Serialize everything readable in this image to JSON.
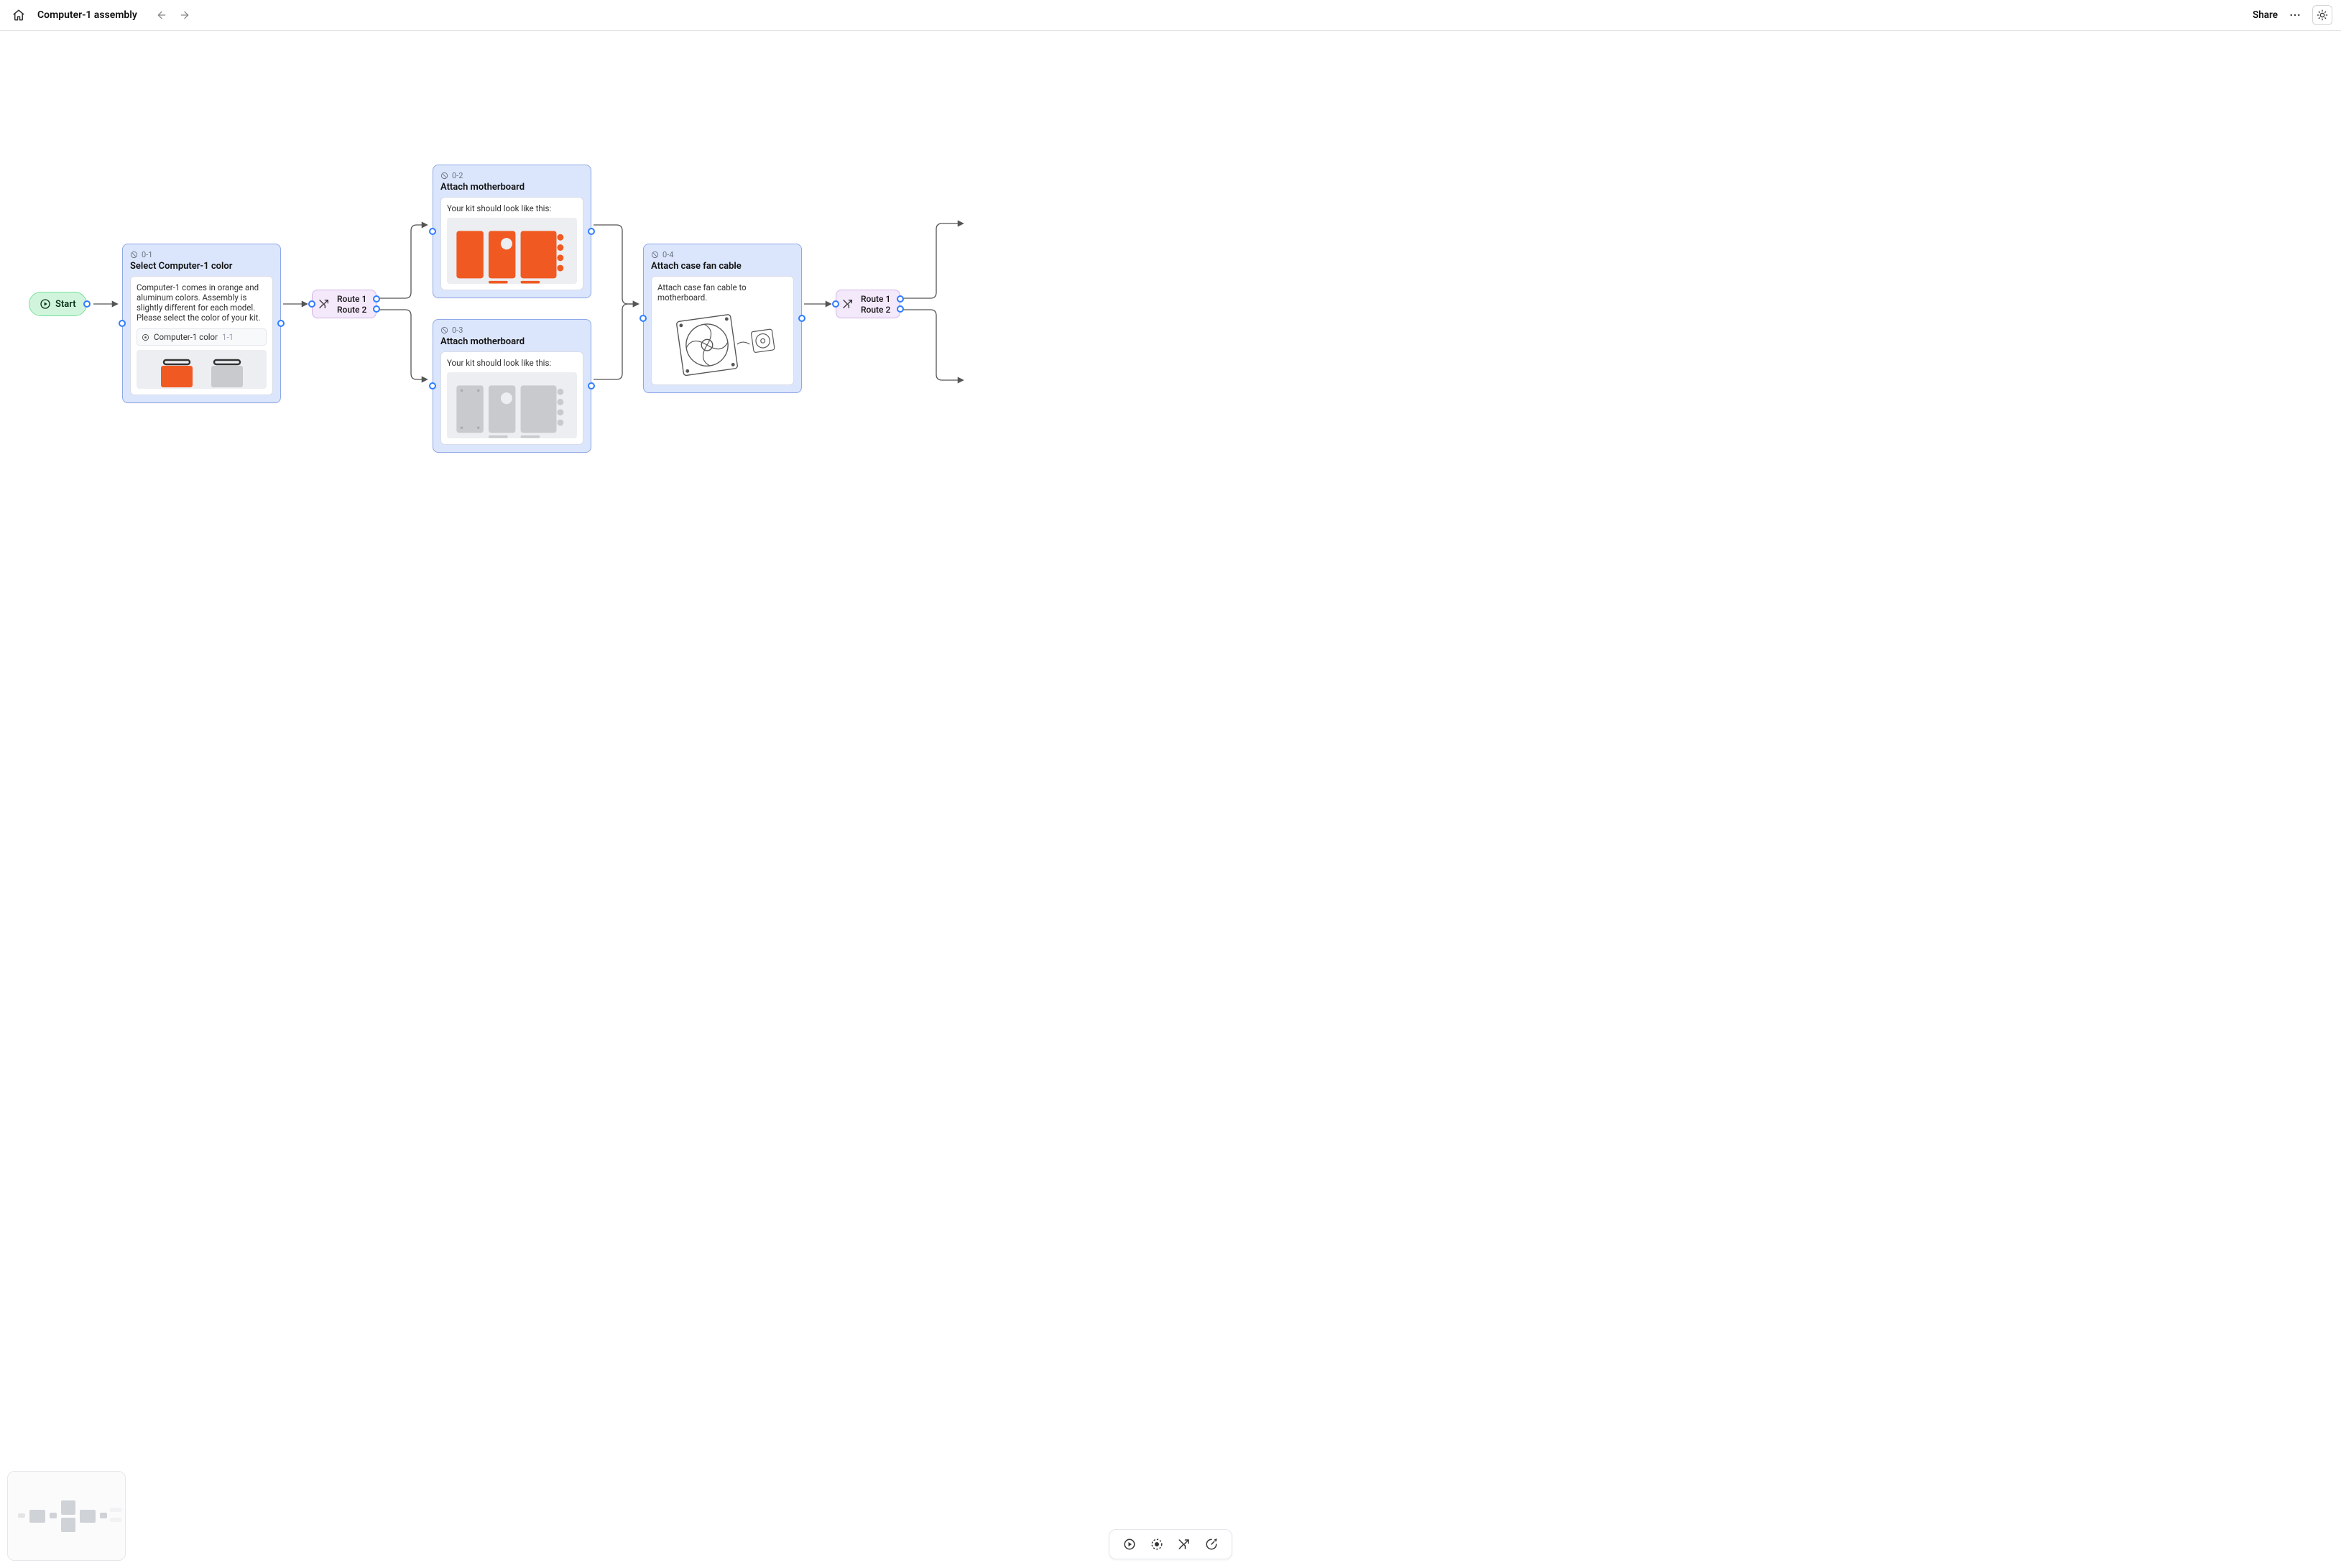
{
  "header": {
    "title": "Computer-1 assembly",
    "share_label": "Share"
  },
  "nodes": {
    "start": {
      "label": "Start"
    },
    "n1": {
      "id": "0-1",
      "title": "Select Computer-1 color",
      "body": "Computer-1 comes in orange and aluminum colors. Assembly is slightly different for each model. Please select the color of your kit.",
      "tag_label": "Computer-1 color",
      "tag_code": "1-1"
    },
    "router1": {
      "route1": "Route 1",
      "route2": "Route 2"
    },
    "n2": {
      "id": "0-2",
      "title": "Attach motherboard",
      "body": "Your kit should look like this:"
    },
    "n3": {
      "id": "0-3",
      "title": "Attach motherboard",
      "body": "Your kit should look like this:"
    },
    "n4": {
      "id": "0-4",
      "title": "Attach case fan cable",
      "body": "Attach case fan cable to motherboard."
    },
    "router2": {
      "route1": "Route 1",
      "route2": "Route 2"
    }
  },
  "colors": {
    "orange": "#f05a22",
    "aluminum": "#b0b3b8"
  }
}
